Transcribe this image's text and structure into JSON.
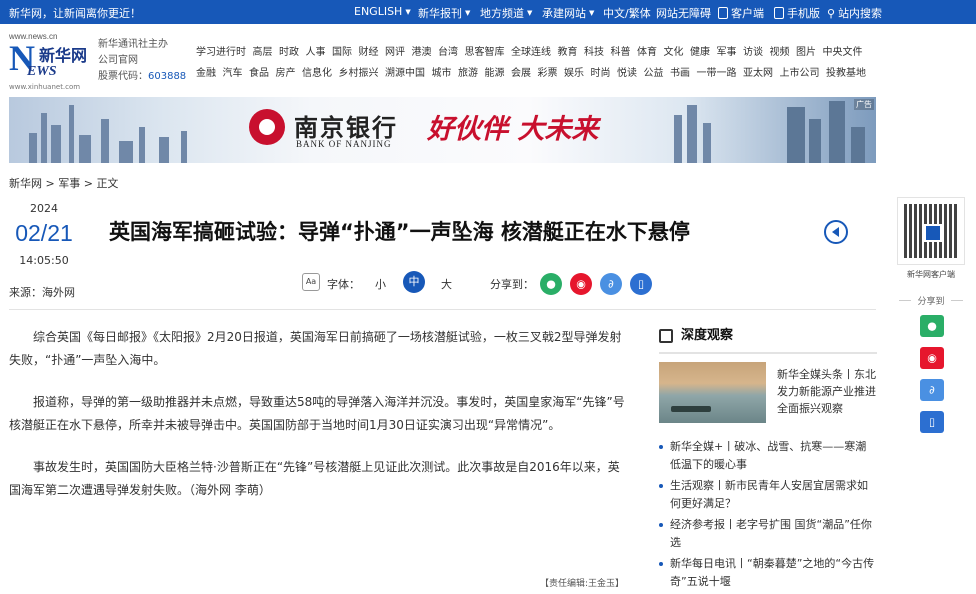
{
  "topbar": {
    "welcome": "新华网，让新闻离你更近！",
    "nav": [
      {
        "label": "ENGLISH",
        "dropdown": true
      },
      {
        "label": "新华报刊",
        "dropdown": true
      },
      {
        "label": "地方频道",
        "dropdown": true
      },
      {
        "label": "承建网站",
        "dropdown": true
      },
      {
        "label": "中文/繁体",
        "dropdown": false
      },
      {
        "label": "网站无障碍",
        "dropdown": false
      },
      {
        "label": "客户端",
        "dropdown": false
      },
      {
        "label": "手机版",
        "dropdown": false
      },
      {
        "label": "站内搜索",
        "dropdown": false
      }
    ]
  },
  "header": {
    "logo": {
      "url": "www.news.cn",
      "cn": "新华网",
      "en_N": "N",
      "en_rest": "EWS",
      "url2": "www.xinhuanet.com"
    },
    "sponsor_line1": "新华通讯社主办",
    "sponsor_line2": "公司官网",
    "stock_label": "股票代码：",
    "stock_code": "603888",
    "nav_row1": [
      "学习进行时",
      "高层",
      "时政",
      "人事",
      "国际",
      "财经",
      "网评",
      "港澳",
      "台湾",
      "思客智库",
      "全球连线",
      "教育",
      "科技",
      "科普",
      "体育",
      "文化",
      "健康",
      "军事",
      "访谈",
      "视频",
      "图片",
      "中央文件"
    ],
    "nav_row2": [
      "金融",
      "汽车",
      "食品",
      "房产",
      "信息化",
      "乡村振兴",
      "溯源中国",
      "城市",
      "旅游",
      "能源",
      "会展",
      "彩票",
      "娱乐",
      "时尚",
      "悦读",
      "公益",
      "书画",
      "一带一路",
      "亚太网",
      "上市公司",
      "投教基地"
    ]
  },
  "banner": {
    "brand_cn": "南京银行",
    "brand_en": "BANK OF NANJING",
    "slogan": "好伙伴 大未来",
    "ad_label": "广告"
  },
  "breadcrumb": [
    "新华网",
    "军事",
    "正文"
  ],
  "article": {
    "year": "2024",
    "month_day": "02/21",
    "time": "14:05:50",
    "source": "来源：海外网",
    "title": "英国海军搞砸试验：导弹“扑通”一声坠海 核潜艇正在水下悬停",
    "font_label": "字体：",
    "font_small": "小",
    "font_medium": "中",
    "font_large": "大",
    "share_label": "分享到：",
    "paragraphs": [
      "综合英国《每日邮报》《太阳报》2月20日报道，英国海军日前搞砸了一场核潜艇试验，一枚三叉戟2型导弹发射失败，“扑通”一声坠入海中。",
      "报道称，导弹的第一级助推器并未点燃，导致重达58吨的导弹落入海洋并沉没。事发时，英国皇家海军“先锋”号核潜艇正在水下悬停，所幸并未被导弹击中。英国国防部于当地时间1月30日证实演习出现“异常情况”。",
      "事故发生时，英国国防大臣格兰特·沙普斯正在“先锋”号核潜艇上见证此次测试。此次事故是自2016年以来，英国海军第二次遭遇导弹发射失败。（海外网 李萌）"
    ],
    "editor": "【责任编辑:王金玉】"
  },
  "sidebar": {
    "section_title": "深度观察",
    "featured_text": "新华全媒头条丨东北发力新能源产业推进全面振兴观察",
    "items": [
      "新华全媒+丨破冰、战雪、抗寒——寒潮低温下的暖心事",
      "生活观察丨新市民青年人安居宜居需求如何更好满足？",
      "经济参考报丨老字号扩围 国货“潮品”任你选",
      "新华每日电讯丨“朝秦暮楚”之地的“今古传奇”五说十堰"
    ]
  },
  "right_rail": {
    "qr_label": "新华网客户端",
    "share_title": "分享到"
  },
  "colors": {
    "brand_blue": "#1758b8",
    "wechat_green": "#2aae67",
    "weibo_red": "#e6162d",
    "link_blue": "#4a90e2",
    "phone_blue": "#2c6fd1"
  }
}
